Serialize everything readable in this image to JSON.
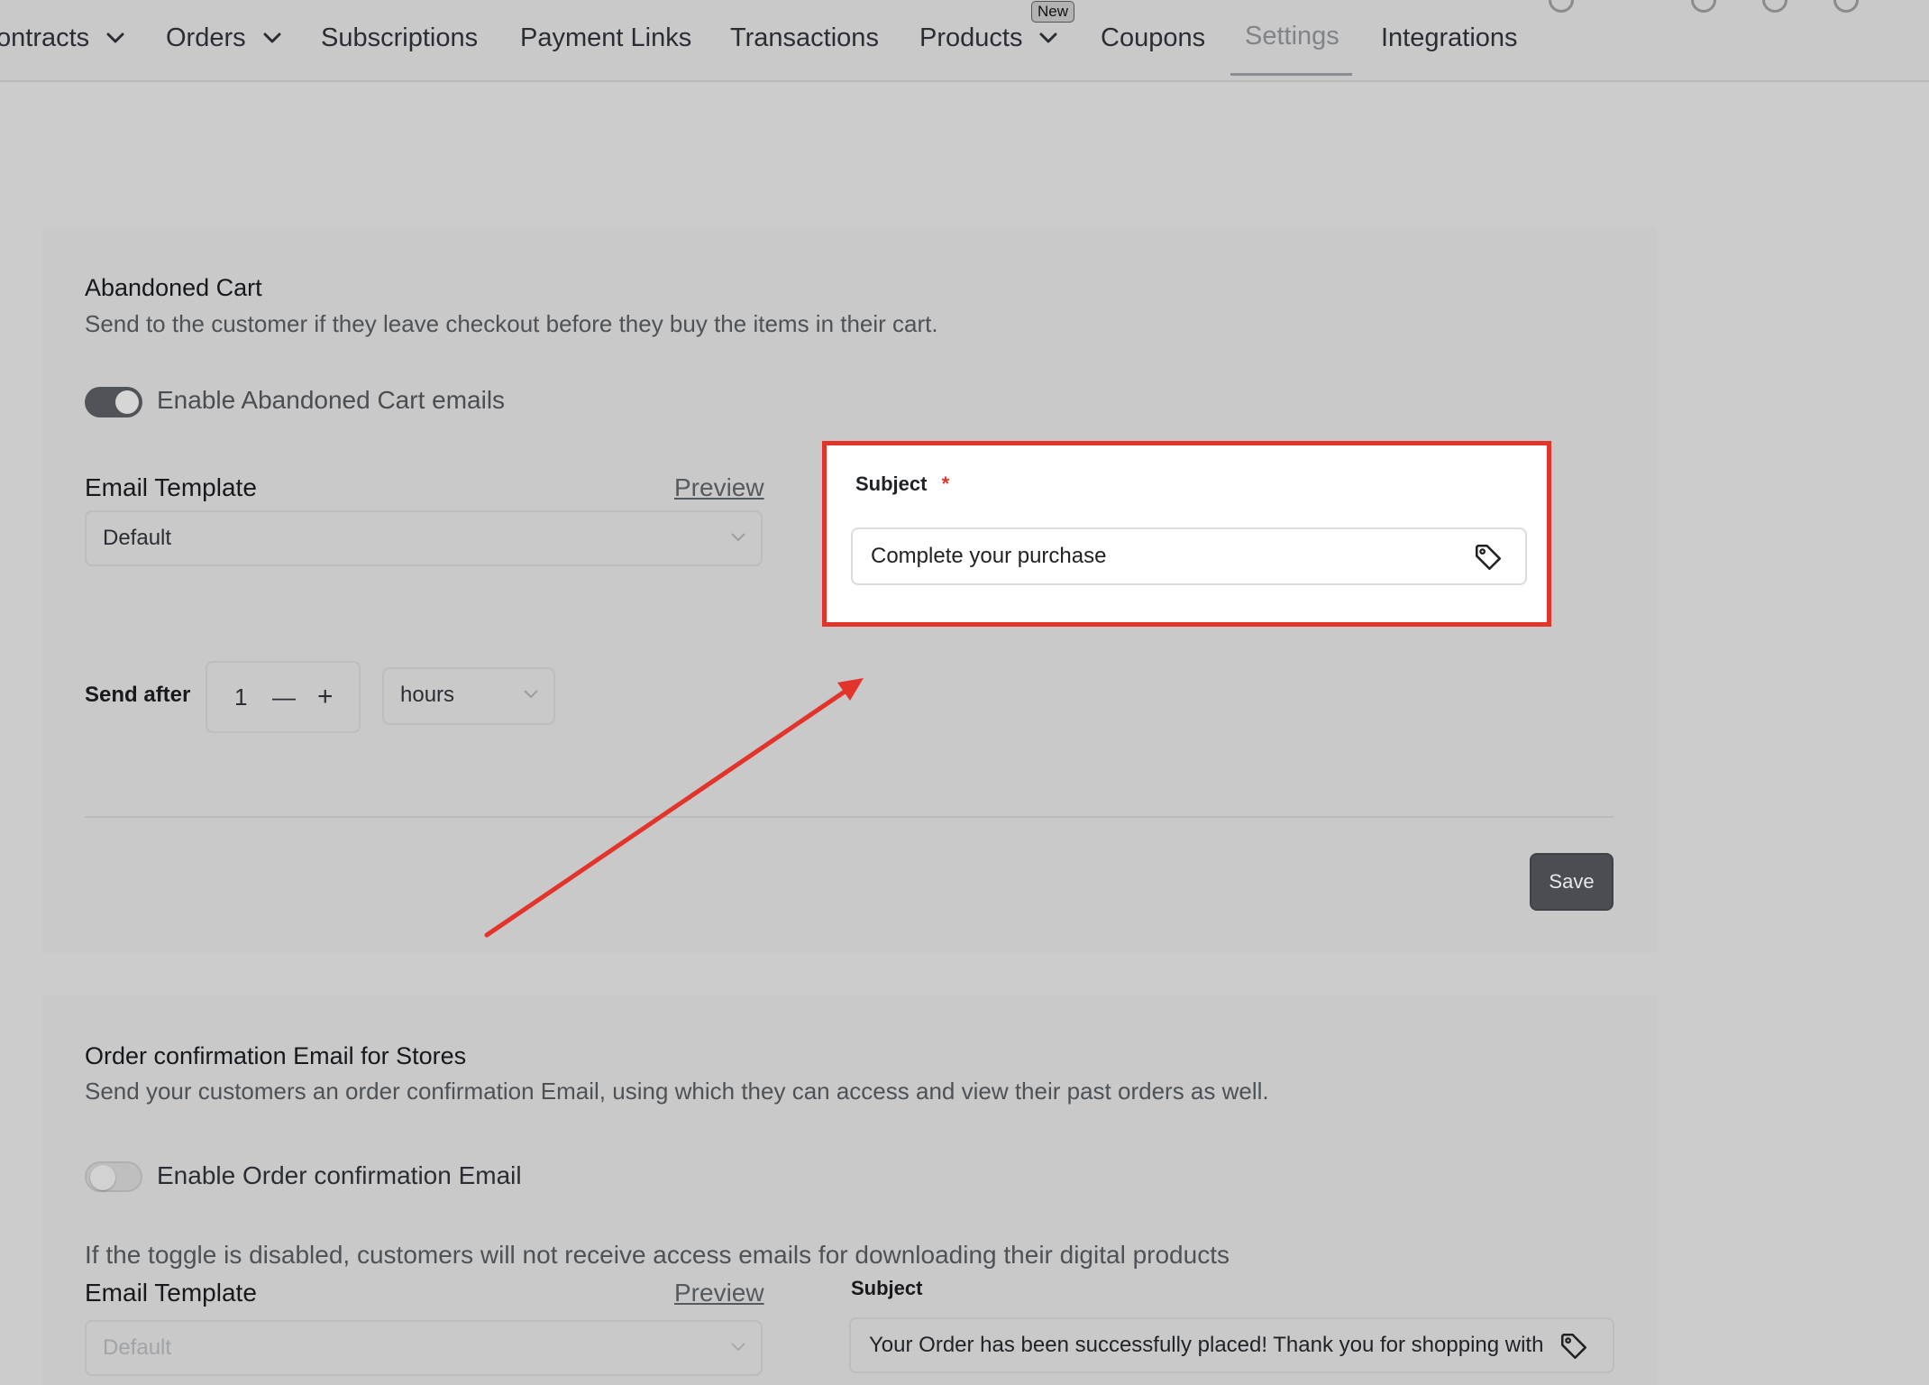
{
  "nav": {
    "items": [
      {
        "label": "ontracts",
        "has_dropdown": true
      },
      {
        "label": "Orders",
        "has_dropdown": true
      },
      {
        "label": "Subscriptions"
      },
      {
        "label": "Payment Links"
      },
      {
        "label": "Transactions"
      },
      {
        "label": "Products",
        "has_dropdown": true,
        "badge": "New"
      },
      {
        "label": "Coupons"
      },
      {
        "label": "Settings",
        "active": true
      },
      {
        "label": "Integrations"
      }
    ]
  },
  "abandoned_cart": {
    "title": "Abandoned Cart",
    "description": "Send to the customer if they leave checkout before they buy the items in their cart.",
    "toggle_label": "Enable Abandoned Cart emails",
    "toggle_on": true,
    "email_template_label": "Email Template",
    "preview_label": "Preview",
    "email_template_value": "Default",
    "subject_label": "Subject",
    "subject_required": "*",
    "subject_value": "Complete your purchase",
    "send_after_label": "Send after",
    "send_after_value": "1",
    "decrement": "—",
    "increment": "+",
    "unit_value": "hours",
    "save_label": "Save"
  },
  "order_confirmation": {
    "title": "Order confirmation Email for Stores",
    "description": "Send your customers an order confirmation Email, using which they can access and view their past orders as well.",
    "toggle_label": "Enable Order confirmation Email",
    "toggle_on": false,
    "note": "If the toggle is disabled, customers will not receive access emails for downloading their digital products",
    "email_template_label": "Email Template",
    "preview_label": "Preview",
    "email_template_value": "Default",
    "subject_label": "Subject",
    "subject_value": "Your Order has been successfully placed! Thank you for shopping with"
  },
  "annotation": {
    "highlight_color": "#e3342b",
    "arrow_color": "#e3342b"
  },
  "icons": [
    "chevron-down-icon",
    "tag-icon",
    "toggle-switch"
  ]
}
